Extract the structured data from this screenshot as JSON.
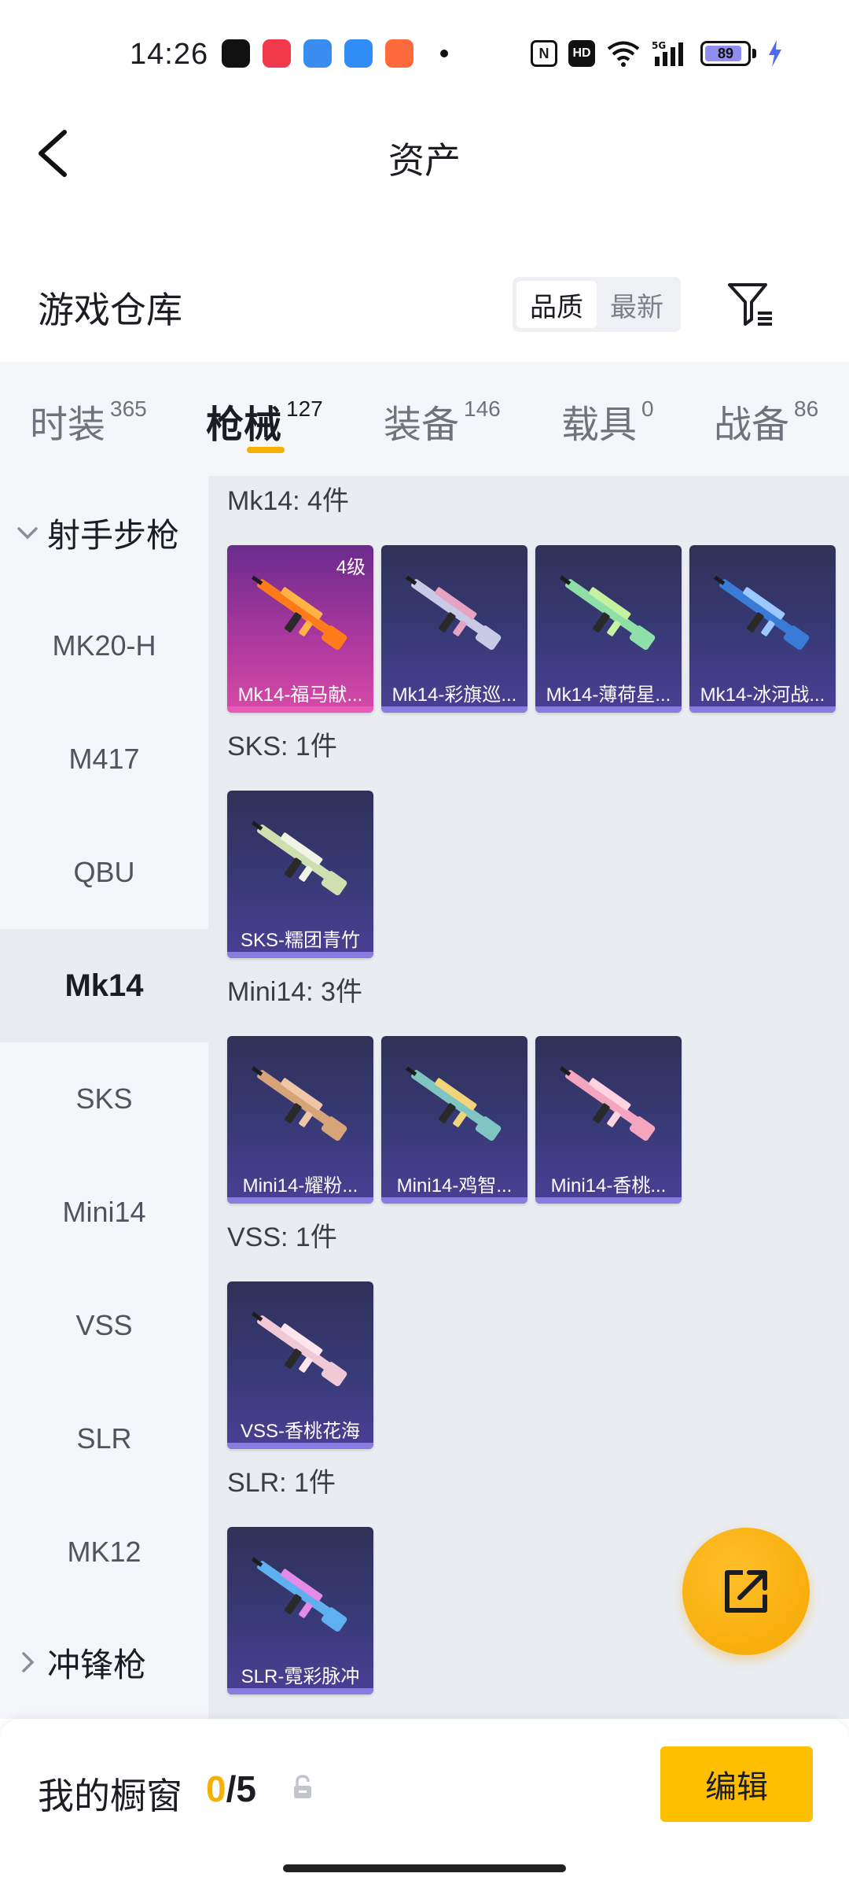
{
  "status_bar": {
    "time": "14:26",
    "network": "5G",
    "hd_badge": "HD",
    "nfc_badge": "N",
    "battery": {
      "percent": 89,
      "text": "89",
      "color": "#8f8ef0"
    },
    "app_icons": [
      {
        "name": "tiktok-icon",
        "color": "#111111"
      },
      {
        "name": "music-icon",
        "color": "#f0394a"
      },
      {
        "name": "browser-icon",
        "color": "#3a8cf0"
      },
      {
        "name": "files-icon",
        "color": "#2f8df5"
      },
      {
        "name": "game-center-icon",
        "color": "#ff6a3d"
      }
    ]
  },
  "nav": {
    "title": "资产"
  },
  "warehouse": {
    "title": "游戏仓库",
    "sort_options": [
      "品质",
      "最新"
    ],
    "active_sort": "品质"
  },
  "tabs": [
    {
      "label": "时装",
      "count": "365"
    },
    {
      "label": "枪械",
      "count": "127",
      "active": true
    },
    {
      "label": "装备",
      "count": "146"
    },
    {
      "label": "载具",
      "count": "0"
    },
    {
      "label": "战备",
      "count": "86"
    }
  ],
  "sidebar": {
    "group_open": "射手步枪",
    "items": [
      "MK20-H",
      "M417",
      "QBU",
      "Mk14",
      "SKS",
      "Mini14",
      "VSS",
      "SLR",
      "MK12"
    ],
    "active_item": "Mk14",
    "group_collapsed": "冲锋枪"
  },
  "sections": [
    {
      "title": "Mk14: 4件",
      "items": [
        {
          "name": "Mk14-福马献...",
          "level": "4级",
          "rarity": "legendary",
          "palette": [
            "#ff7a1a",
            "#ffb347"
          ]
        },
        {
          "name": "Mk14-彩旗巡...",
          "rarity": "epic",
          "palette": [
            "#c9cbe6",
            "#e7a3c2"
          ]
        },
        {
          "name": "Mk14-薄荷星...",
          "rarity": "epic",
          "palette": [
            "#8fe0a8",
            "#c6f2a0"
          ]
        },
        {
          "name": "Mk14-冰河战...",
          "rarity": "epic",
          "palette": [
            "#3a7bd8",
            "#9ac8ff"
          ]
        }
      ]
    },
    {
      "title": "SKS: 1件",
      "items": [
        {
          "name": "SKS-糯团青竹",
          "rarity": "epic",
          "palette": [
            "#cfe0b0",
            "#f2f4e8"
          ]
        }
      ]
    },
    {
      "title": "Mini14: 3件",
      "items": [
        {
          "name": "Mini14-耀粉...",
          "rarity": "epic",
          "palette": [
            "#d7a47a",
            "#f0c7a6"
          ]
        },
        {
          "name": "Mini14-鸡智...",
          "rarity": "epic",
          "palette": [
            "#7fc6c2",
            "#f2d47a"
          ]
        },
        {
          "name": "Mini14-香桃...",
          "rarity": "epic",
          "palette": [
            "#f4a6c0",
            "#ffd3e0"
          ]
        }
      ]
    },
    {
      "title": "VSS: 1件",
      "items": [
        {
          "name": "VSS-香桃花海",
          "rarity": "epic",
          "palette": [
            "#f1c9d6",
            "#ffe6ee"
          ]
        }
      ]
    },
    {
      "title": "SLR: 1件",
      "items": [
        {
          "name": "SLR-霓彩脉冲",
          "rarity": "epic",
          "palette": [
            "#5fb0f0",
            "#e58ae6"
          ]
        }
      ]
    }
  ],
  "showcase": {
    "label": "我的橱窗",
    "count": "0",
    "separator": "/",
    "max": "5"
  },
  "edit_button": "编辑",
  "colors": {
    "accent": "#f5b100",
    "card_epic": "#383a78",
    "card_legendary": "#b0399f"
  }
}
